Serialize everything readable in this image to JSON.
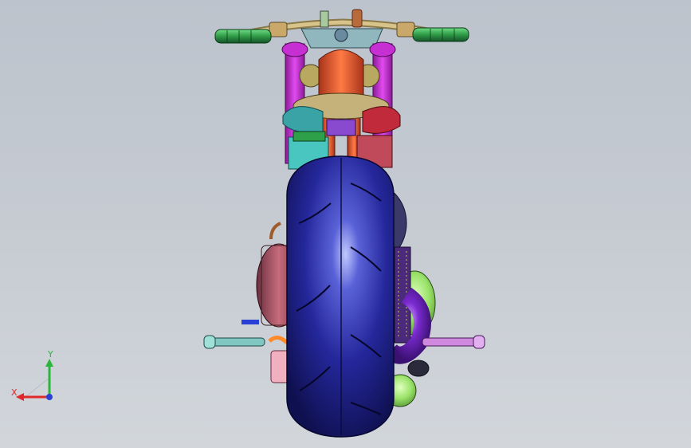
{
  "view": {
    "type": "3d-cad-viewport",
    "model": "motorcycle-rear-view",
    "background_colors": [
      "#bcc3cc",
      "#d2d6db"
    ]
  },
  "triad": {
    "x_label": "X",
    "y_label": "Y",
    "x_color": "#e0282a",
    "y_color": "#2bb53a",
    "z_color": "#2a3fd6"
  },
  "colors": {
    "grip": "#2f9a45",
    "handlebar": "#c8b27a",
    "fork": "#c62fd1",
    "body": "#e0582a",
    "seat": "#3aa3a6",
    "tire": "#1d1f7a",
    "chain_guard": "#6a2aa0",
    "footpeg_left": "#7fc7c0",
    "footpeg_right": "#cf8ae0",
    "exhaust": "#7a2ad0",
    "green_part": "#9be36a"
  }
}
